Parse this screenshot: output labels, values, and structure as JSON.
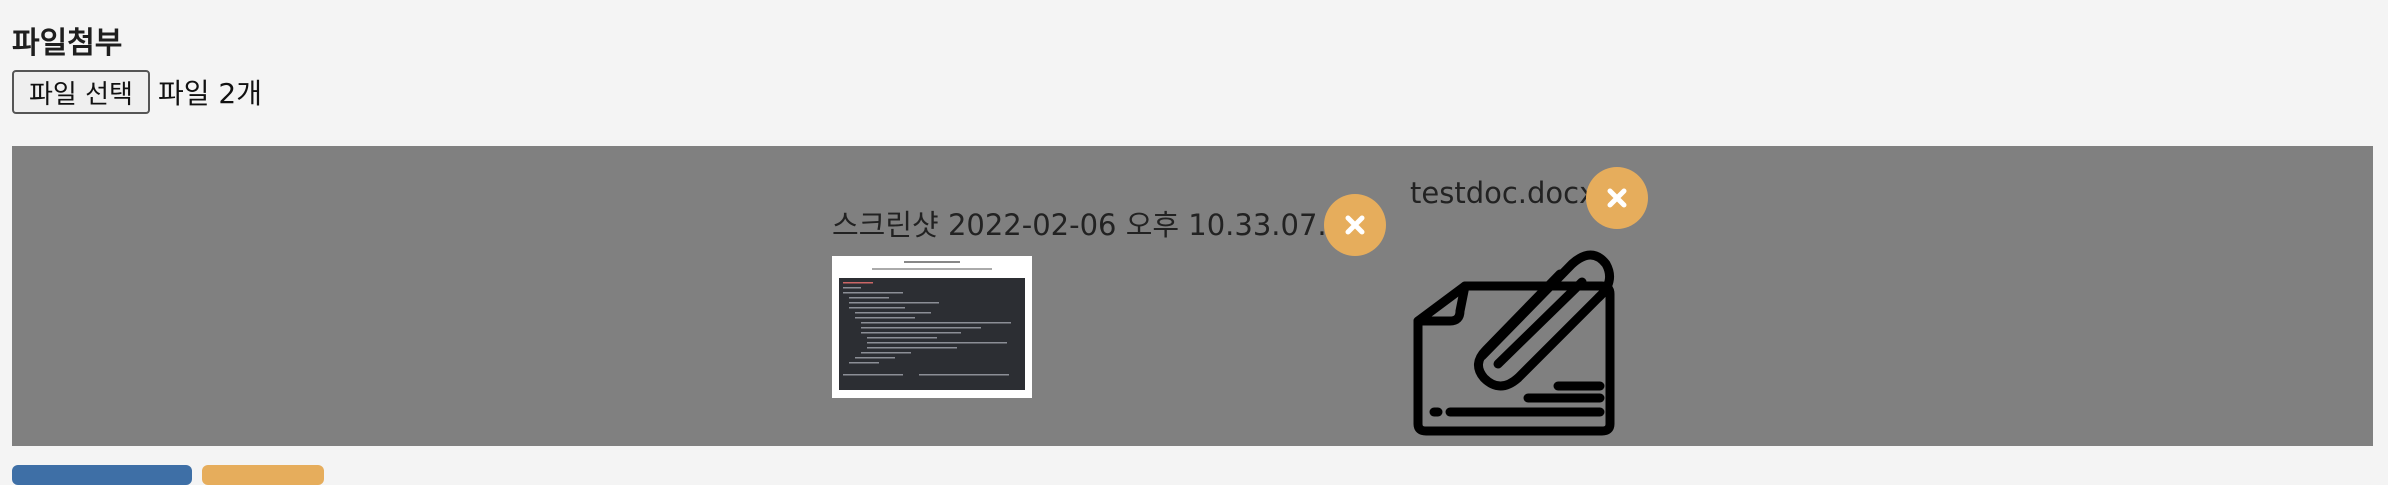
{
  "form": {
    "attach_label": "파일첨부",
    "choose_button": "파일 선택",
    "file_count": "파일 2개"
  },
  "preview": {
    "files": [
      {
        "name": "스크린샷 2022-02-06 오후 10.33.07.png",
        "kind": "image",
        "remove_icon": "close-icon"
      },
      {
        "name": "testdoc.docx",
        "kind": "document",
        "icon": "paperclip-folder-icon",
        "remove_icon": "close-icon"
      }
    ]
  },
  "colors": {
    "page_bg": "#f4f4f4",
    "preview_bg": "#808080",
    "remove_button": "#e6ad5c",
    "primary_button": "#3e6fa6",
    "secondary_button": "#e6ad5c"
  }
}
